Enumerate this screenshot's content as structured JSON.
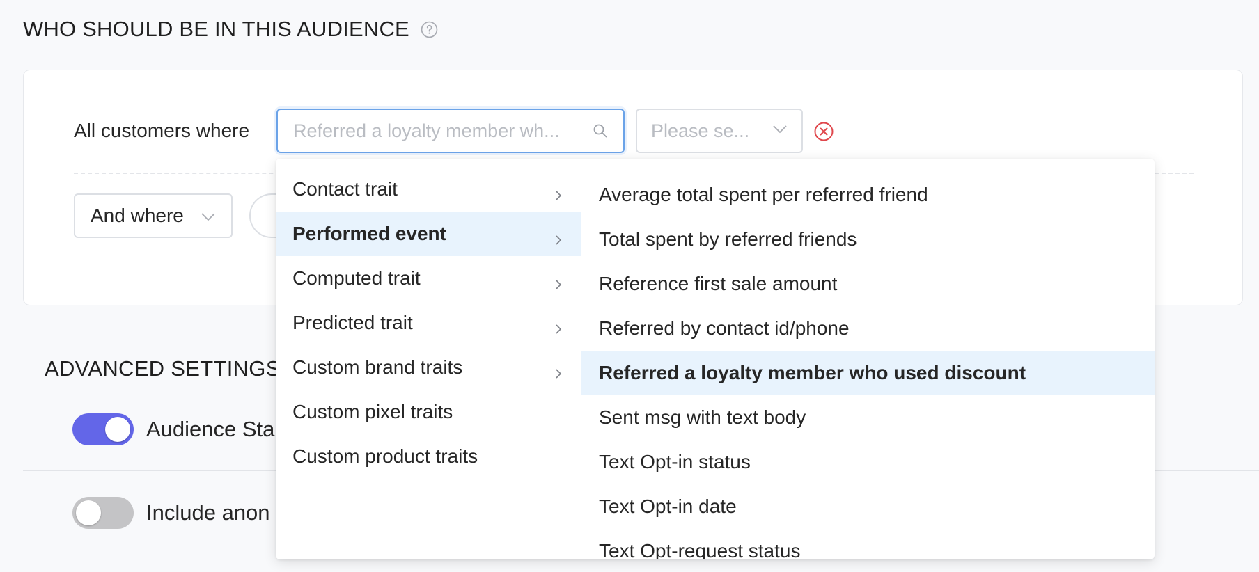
{
  "header": {
    "title": "WHO SHOULD BE IN THIS AUDIENCE",
    "help_icon": "question-circle-icon"
  },
  "filter": {
    "row_label": "All customers where",
    "search_placeholder": "Referred a loyalty member wh...",
    "select_placeholder": "Please se...",
    "and_where_label": "And where"
  },
  "advanced": {
    "title": "ADVANCED SETTINGS",
    "toggles": [
      {
        "label": "Audience Sta",
        "on": true
      },
      {
        "label": "Include anon",
        "on": false
      }
    ]
  },
  "dropdown": {
    "categories": [
      {
        "label": "Contact trait",
        "has_submenu": true,
        "active": false
      },
      {
        "label": "Performed event",
        "has_submenu": true,
        "active": true
      },
      {
        "label": "Computed trait",
        "has_submenu": true,
        "active": false
      },
      {
        "label": "Predicted trait",
        "has_submenu": true,
        "active": false
      },
      {
        "label": "Custom brand traits",
        "has_submenu": true,
        "active": false
      },
      {
        "label": "Custom pixel traits",
        "has_submenu": false,
        "active": false
      },
      {
        "label": "Custom product traits",
        "has_submenu": false,
        "active": false
      }
    ],
    "options": [
      {
        "label": "Average total spent per referred friend",
        "active": false
      },
      {
        "label": "Total spent by referred friends",
        "active": false
      },
      {
        "label": "Reference first sale amount",
        "active": false
      },
      {
        "label": "Referred by contact id/phone",
        "active": false
      },
      {
        "label": "Referred a loyalty member who used discount",
        "active": true
      },
      {
        "label": "Sent msg with text body",
        "active": false
      },
      {
        "label": "Text Opt-in status",
        "active": false
      },
      {
        "label": "Text Opt-in date",
        "active": false
      },
      {
        "label": "Text Opt-request status",
        "active": false
      }
    ]
  },
  "colors": {
    "accent": "#6366e8",
    "highlight": "#e8f3fd",
    "focus_border": "#6ba3e8",
    "remove_red": "#e0474c"
  }
}
